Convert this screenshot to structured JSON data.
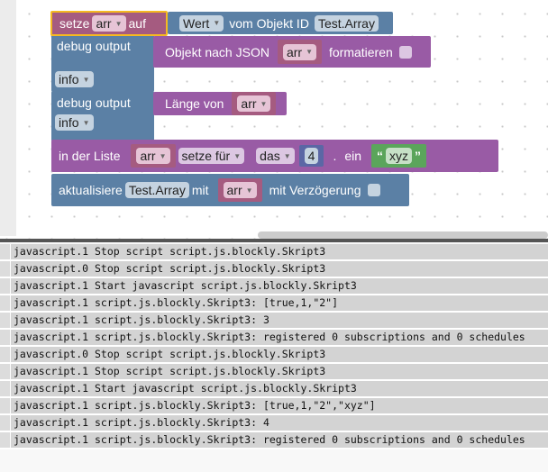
{
  "blocks": {
    "set_var": {
      "label": "setze",
      "var": "arr",
      "on": "auf"
    },
    "get_value": {
      "field": "Wert",
      "text": "vom Objekt ID",
      "object_id": "Test.Array"
    },
    "debug1": {
      "label": "debug output",
      "level": "info"
    },
    "json": {
      "label": "Objekt nach JSON",
      "var": "arr",
      "format_label": "formatieren"
    },
    "debug2": {
      "label": "debug output",
      "level": "info"
    },
    "length": {
      "label": "Länge von",
      "var": "arr"
    },
    "list": {
      "label": "in der Liste",
      "var": "arr",
      "mode": "setze für",
      "where": "das",
      "index": "4",
      "dot": ".",
      "insert": "ein",
      "open_quote": "“",
      "value": "xyz",
      "close_quote": "”"
    },
    "update": {
      "label": "aktualisiere",
      "object_id": "Test.Array",
      "with": "mit",
      "var": "arr",
      "delay_label": "mit Verzögerung"
    }
  },
  "colors": {
    "variables": "#a55b80",
    "io": "#5b80a5",
    "lists": "#995ba5",
    "text": "#5ba55b",
    "selected_outline": "#f5b921"
  },
  "log": [
    "javascript.1 Stop script script.js.blockly.Skript3",
    "javascript.0 Stop script script.js.blockly.Skript3",
    "javascript.1 Start javascript script.js.blockly.Skript3",
    "javascript.1 script.js.blockly.Skript3: [true,1,\"2\"]",
    "javascript.1 script.js.blockly.Skript3: 3",
    "javascript.1 script.js.blockly.Skript3: registered 0 subscriptions and 0 schedules",
    "javascript.0 Stop script script.js.blockly.Skript3",
    "javascript.1 Stop script script.js.blockly.Skript3",
    "javascript.1 Start javascript script.js.blockly.Skript3",
    "javascript.1 script.js.blockly.Skript3: [true,1,\"2\",\"xyz\"]",
    "javascript.1 script.js.blockly.Skript3: 4",
    "javascript.1 script.js.blockly.Skript3: registered 0 subscriptions and 0 schedules"
  ]
}
